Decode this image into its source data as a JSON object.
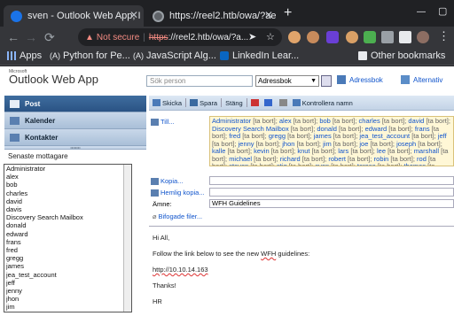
{
  "browser": {
    "tabs": [
      {
        "title": "sven - Outlook Web App, I",
        "favicon_color": "#1a73e8"
      },
      {
        "title": "https://reel2.htb/owa/?ae",
        "favicon_color": "#9aa0a6"
      }
    ],
    "new_tab_label": "+",
    "address": {
      "security_label": "Not secure",
      "separator": "|",
      "url_scheme": "https",
      "url_rest": "://reel2.htb/owa/?a..."
    },
    "bookmarks": [
      {
        "label": "Apps",
        "icon": "apps-grid-icon"
      },
      {
        "label": "Python for Pe...",
        "icon": "python-icon"
      },
      {
        "label": "JavaScript Alg...",
        "icon": "freecodecamp-icon"
      },
      {
        "label": "LinkedIn Lear...",
        "icon": "linkedin-icon"
      }
    ],
    "other_bookmarks": "Other bookmarks",
    "colors": {
      "chrome_dark": "#202124",
      "toolbar": "#35363a",
      "warning": "#f28b82"
    }
  },
  "owa": {
    "brand_small": "Microsoft",
    "brand": "Outlook Web App",
    "search_placeholder": "Sök person",
    "address_book_select": "Adressbok",
    "address_book_link": "Adressbok",
    "options_link": "Alternativ",
    "nav": [
      {
        "label": "Post",
        "selected": true,
        "icon": "mail-icon"
      },
      {
        "label": "Kalender",
        "selected": false,
        "icon": "calendar-icon"
      },
      {
        "label": "Kontakter",
        "selected": false,
        "icon": "contacts-icon"
      }
    ],
    "recent_label": "Senaste mottagare",
    "recent_recipients": [
      "Administrator",
      "alex",
      "bob",
      "charles",
      "david",
      "davis",
      "Discovery Search Mailbox",
      "donald",
      "edward",
      "frans",
      "fred",
      "gregg",
      "james",
      "jea_test_account",
      "jeff",
      "jenny",
      "jhon",
      "jim"
    ],
    "toolbar": {
      "send": "Skicka",
      "save": "Spara",
      "close": "Stäng",
      "check_names": "Kontrollera namn"
    },
    "fields": {
      "to_label": "Till...",
      "cc_label": "Kopia...",
      "bcc_label": "Hemlig kopia...",
      "subject_label": "Ämne:",
      "subject_value": "WFH Guidelines",
      "attach_label": "Bifogade filer..."
    },
    "to_recipients": [
      "Administrator",
      "alex",
      "bob",
      "charles",
      "david",
      "Discovery Search Mailbox",
      "donald",
      "edward",
      "frans",
      "fred",
      "gregg",
      "james",
      "jea_test_account",
      "jeff",
      "jenny",
      "jhon",
      "jim",
      "joe",
      "joseph",
      "kalle",
      "kevin",
      "knut",
      "lars",
      "lee",
      "marshall",
      "michael",
      "richard",
      "robert",
      "robin",
      "rod",
      "steven",
      "stig",
      "sven",
      "teresa",
      "thomas",
      "william"
    ],
    "remove_label": "[ta bort]",
    "body": {
      "greeting": "Hi All,",
      "line1": "Follow the link below to see the new WFH guidelines:",
      "link": "http://10.10.14.163",
      "thanks": "Thanks!",
      "signature": "HR"
    },
    "colors": {
      "nav_selected": "#2a5384",
      "to_box_bg": "#fff7d6",
      "link": "#1155cc"
    }
  }
}
